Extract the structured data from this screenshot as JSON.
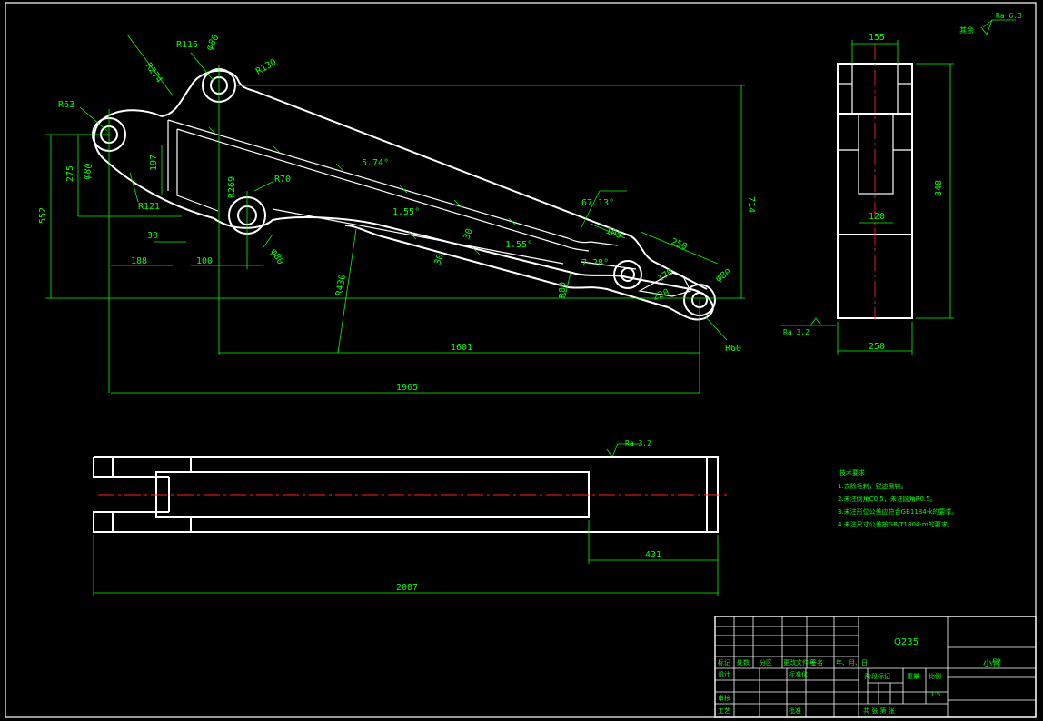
{
  "main_view": {
    "radii": [
      "R116",
      "R274",
      "R130",
      "R63",
      "R121",
      "R269",
      "R70",
      "R80",
      "R430",
      "R80",
      "R60"
    ],
    "diameters": [
      "φ80",
      "φ80",
      "φ80",
      "φ80"
    ],
    "angles": [
      "5.74°",
      "1.55°",
      "1.55°",
      "67.13°",
      "7.28°"
    ],
    "linear": {
      "d275": "275",
      "d552": "552",
      "d197": "197",
      "d714": "714",
      "d30a": "30",
      "d30b": "30",
      "d30c": "30",
      "d188": "188",
      "d100": "100",
      "d105": "105",
      "d250": "250",
      "d170": "170",
      "d220": "220",
      "d1601": "1601",
      "d1965": "1965"
    }
  },
  "side_view": {
    "top": "155",
    "inner": "120",
    "height": "848",
    "bottom": "250"
  },
  "bottom_view": {
    "offset": "431",
    "length": "2087"
  },
  "roughness": {
    "default": "Ra 6.3",
    "side": "Ra 3.2",
    "bottom": "Ra 3.2",
    "other_label": "其余"
  },
  "technical_notes": {
    "title": "技术要求",
    "items": [
      "1.去除毛刺，锐边倒钝。",
      "2.未注倒角C0.5，未注圆角R0.5。",
      "3.未注形位公差应符合GB1184-k的要求。",
      "4.未注尺寸公差按GB/T1804-m的要求。"
    ]
  },
  "title_block": {
    "material": "Q235",
    "part_name": "小臂",
    "scale": "1:5",
    "row_labels": [
      "标记",
      "处数",
      "分区",
      "更改文件号",
      "签名",
      "年、月、日"
    ],
    "designer_label": "设计",
    "standardize_label": "标准化",
    "review_label": "审核",
    "process_label": "工艺",
    "approve_label": "批准",
    "stage_label": "阶段标记",
    "weight_label": "重量",
    "ratio_label": "比例",
    "sheet_text": "共    张    第    张"
  }
}
